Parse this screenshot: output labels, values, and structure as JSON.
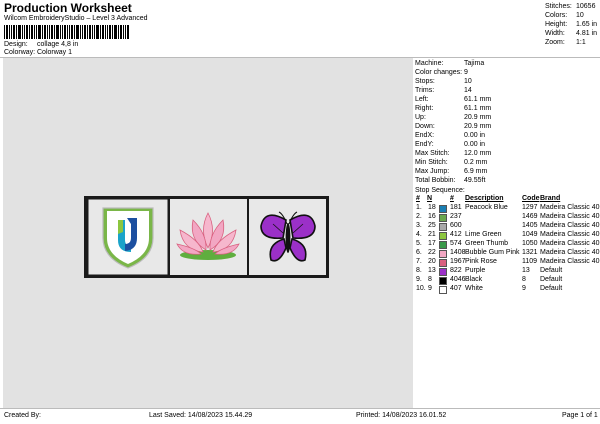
{
  "header": {
    "title": "Production Worksheet",
    "subtitle": "Wilcom EmbroideryStudio – Level 3 Advanced",
    "design_label": "Design:",
    "design_value": "collage 4,8 in",
    "colorway_label": "Colorway:",
    "colorway_value": "Colorway 1"
  },
  "stats": [
    {
      "label": "Stitches:",
      "value": "10656"
    },
    {
      "label": "Colors:",
      "value": "10"
    },
    {
      "label": "Height:",
      "value": "1.65 in"
    },
    {
      "label": "Width:",
      "value": "4.81 in"
    },
    {
      "label": "Zoom:",
      "value": "1:1"
    }
  ],
  "machine_info": [
    {
      "label": "Machine:",
      "value": "Tajima"
    },
    {
      "label": "Color changes:",
      "value": "9"
    },
    {
      "label": "Stops:",
      "value": "10"
    },
    {
      "label": "Trims:",
      "value": "14"
    },
    {
      "label": "Left:",
      "value": "61.1 mm"
    },
    {
      "label": "Right:",
      "value": "61.1 mm"
    },
    {
      "label": "Up:",
      "value": "20.9 mm"
    },
    {
      "label": "Down:",
      "value": "20.9 mm"
    },
    {
      "label": "EndX:",
      "value": "0.00 in"
    },
    {
      "label": "EndY:",
      "value": "0.00 in"
    },
    {
      "label": "Max Stitch:",
      "value": "12.0 mm"
    },
    {
      "label": "Min Stitch:",
      "value": "0.2 mm"
    },
    {
      "label": "Max Jump:",
      "value": "6.9 mm"
    },
    {
      "label": "Total Bobbin:",
      "value": "49.55ft"
    }
  ],
  "stop_sequence": {
    "title": "Stop Sequence:",
    "columns": [
      "#",
      "N",
      "",
      "#",
      "Description",
      "Code",
      "Brand"
    ],
    "rows": [
      {
        "num": "1.",
        "n": "18",
        "color": "#1a7fb3",
        "thread": "181",
        "desc": "Peacock Blue",
        "code": "1297",
        "brand": "Madeira Classic 40"
      },
      {
        "num": "2.",
        "n": "16",
        "color": "#6aa84f",
        "thread": "237",
        "desc": "",
        "code": "1469",
        "brand": "Madeira Classic 40"
      },
      {
        "num": "3.",
        "n": "25",
        "color": "#a9a9a9",
        "thread": "600",
        "desc": "",
        "code": "1405",
        "brand": "Madeira Classic 40"
      },
      {
        "num": "4.",
        "n": "21",
        "color": "#8cc63f",
        "thread": "412",
        "desc": "Lime Green",
        "code": "1049",
        "brand": "Madeira Classic 40"
      },
      {
        "num": "5.",
        "n": "17",
        "color": "#3a9a4a",
        "thread": "574",
        "desc": "Green Thumb",
        "code": "1050",
        "brand": "Madeira Classic 40"
      },
      {
        "num": "6.",
        "n": "22",
        "color": "#f2a7c3",
        "thread": "1408",
        "desc": "Bubble Gum Pink",
        "code": "1321",
        "brand": "Madeira Classic 40"
      },
      {
        "num": "7.",
        "n": "20",
        "color": "#d9607f",
        "thread": "1967",
        "desc": "Pink Rose",
        "code": "1109",
        "brand": "Madeira Classic 40"
      },
      {
        "num": "8.",
        "n": "13",
        "color": "#9b30c8",
        "thread": "822",
        "desc": "Purple",
        "code": "13",
        "brand": "Default"
      },
      {
        "num": "9.",
        "n": "8",
        "color": "#000000",
        "thread": "4046",
        "desc": "Black",
        "code": "8",
        "brand": "Default"
      },
      {
        "num": "10.",
        "n": "9",
        "color": "#ffffff",
        "thread": "407",
        "desc": "White",
        "code": "9",
        "brand": "Default"
      }
    ]
  },
  "footer": {
    "created_by": "Created By:",
    "last_saved": "Last Saved: 14/08/2023 15.44.29",
    "printed": "Printed: 14/08/2023 16.01.52",
    "page": "Page 1 of 1"
  }
}
